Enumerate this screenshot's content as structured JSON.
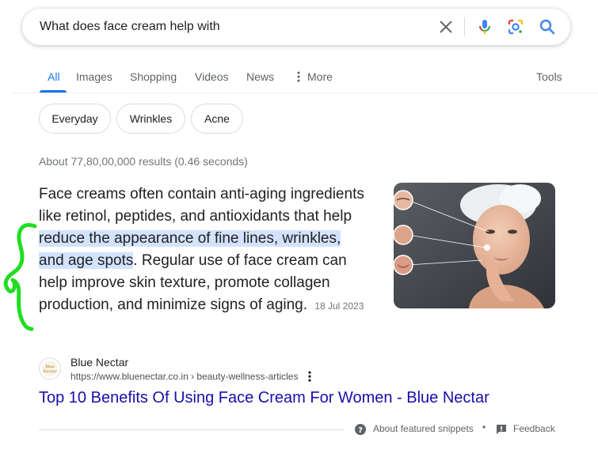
{
  "search": {
    "query": "What does face cream help with",
    "icons": [
      "clear-icon",
      "microphone-icon",
      "google-lens-icon",
      "search-icon"
    ]
  },
  "tabs": {
    "items": [
      {
        "label": "All",
        "active": true
      },
      {
        "label": "Images"
      },
      {
        "label": "Shopping"
      },
      {
        "label": "Videos"
      },
      {
        "label": "News"
      },
      {
        "label": "More",
        "icon": "more-vert-icon"
      }
    ],
    "tools": "Tools"
  },
  "chips": [
    "Everyday",
    "Wrinkles",
    "Acne"
  ],
  "result_stats": "About 77,80,00,000 results (0.46 seconds)",
  "snippet": {
    "part1": "Face creams often contain anti-aging ingredients like retinol, peptides, and antioxidants that help ",
    "highlight": "reduce the appearance of fine lines, wrinkles, and age spots",
    "part2": ". Regular use of face cream can help improve skin texture, promote collagen production, and minimize signs of aging.",
    "date": "18 Jul 2023"
  },
  "source": {
    "name": "Blue Nectar",
    "url": "https://www.bluenectar.co.in",
    "breadcrumb": " › beauty-wellness-articles",
    "favicon_text": "Blue Nectar"
  },
  "result": {
    "title": "Top 10 Benefits Of Using Face Cream For Women - Blue Nectar"
  },
  "footer": {
    "about": "About featured snippets",
    "separator": "•",
    "feedback": "Feedback"
  },
  "colors": {
    "accent": "#1a73e8",
    "link": "#1a0dab",
    "highlight": "#d3e3fd",
    "annotation": "#22dd22"
  }
}
